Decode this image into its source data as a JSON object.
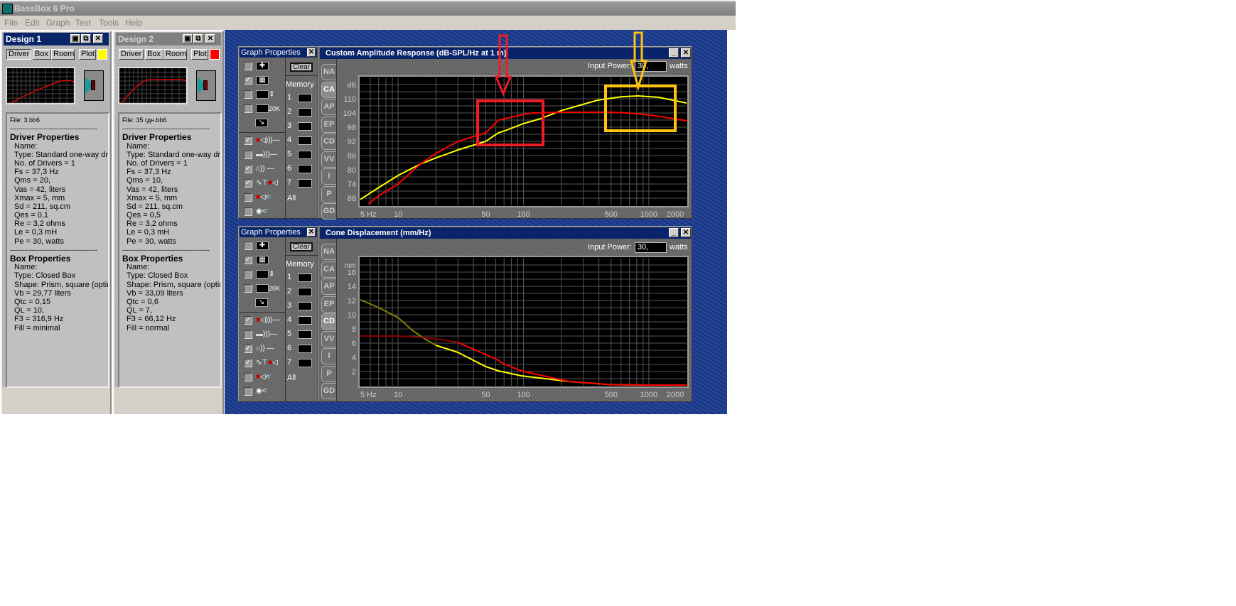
{
  "app": {
    "title": "BassBox 6 Pro",
    "menu": [
      "File",
      "Edit",
      "Graph",
      "Test",
      "Tools",
      "Help"
    ]
  },
  "designs": [
    {
      "title": "Design 1",
      "buttons": [
        "Driver",
        "Box",
        "Room",
        "Plot"
      ],
      "plot_color": "#ffff00",
      "file": "File: 3.bb6",
      "separator": "-----------------------------------------",
      "driver_heading": "Driver Properties",
      "driver_lines": [
        "Name:",
        "Type: Standard one-way driver",
        "No. of Drivers = 1",
        "Fs =  37,3 Hz",
        "Qms =  20,",
        "Vas =  42, liters",
        "Xmax =  5, mm",
        "Sd =  211, sq.cm",
        "Qes =  0,1",
        "Re =  3,2 ohms",
        "Le =  0,3 mH",
        "Pe =  30, watts"
      ],
      "box_heading": "Box Properties",
      "box_lines": [
        "Name:",
        "Type: Closed Box",
        "Shape: Prism, square (optimum)",
        "Vb =  29,77 liters",
        "Qtc =  0,15",
        "QL =  10,",
        "F3 =  316,9 Hz",
        "Fill = minimal"
      ]
    },
    {
      "title": "Design 2",
      "buttons": [
        "Driver",
        "Box",
        "Room",
        "Plot"
      ],
      "plot_color": "#ff0000",
      "file": "File: 35 гдн.bb6",
      "separator": "-----------------------------------------",
      "driver_heading": "Driver Properties",
      "driver_lines": [
        "Name:",
        "Type: Standard one-way driver",
        "No. of Drivers = 1",
        "Fs =  37,3 Hz",
        "Qms =  10,",
        "Vas =  42, liters",
        "Xmax =  5, mm",
        "Sd =  211, sq.cm",
        "Qes =  0,5",
        "Re =  3,2 ohms",
        "Le =  0,3 mH",
        "Pe =  30, watts"
      ],
      "box_heading": "Box Properties",
      "box_lines": [
        "Name:",
        "Type: Closed Box",
        "Shape: Prism, square (optimum)",
        "Vb =  33,09 liters",
        "Qtc =  0,6",
        "QL =  7,",
        "F3 =  66,12 Hz",
        "Fill = normal"
      ]
    }
  ],
  "graph_properties": {
    "title": "Graph Properties",
    "clear_label": "Clear",
    "memory_label": "Memory",
    "memory_slots": [
      "1",
      "2",
      "3",
      "4",
      "5",
      "6",
      "7"
    ],
    "all_label": "All",
    "options_top": [
      {
        "icon": "cursor-icon",
        "checked": false
      },
      {
        "icon": "grid-icon",
        "checked": true
      },
      {
        "icon": "autoscale-icon",
        "checked": false
      },
      {
        "icon": "extend-20k-icon",
        "checked": false
      }
    ],
    "extend_label": "20K",
    "options_bottom": [
      {
        "icon": "driver-response-icon",
        "checked": true
      },
      {
        "icon": "box-response-icon",
        "checked": false
      },
      {
        "icon": "room-response-icon",
        "checked": true
      },
      {
        "icon": "crossover-response-icon",
        "checked": true
      },
      {
        "icon": "driver-target-icon",
        "checked": false
      },
      {
        "icon": "box-target-icon",
        "checked": false
      }
    ]
  },
  "tabs": [
    "NA",
    "CA",
    "AP",
    "EP",
    "CD",
    "VV",
    "I",
    "P",
    "GD"
  ],
  "windows": [
    {
      "title": "Custom Amplitude Response (dB-SPL/Hz at 1 m)",
      "active_tab": "CA",
      "input_power_label": "Input Power:",
      "input_power_value": "30,",
      "units": "watts"
    },
    {
      "title": "Cone Displacement (mm/Hz)",
      "active_tab": "CD",
      "input_power_label": "Input Power:",
      "input_power_value": "30,",
      "units": "watts"
    }
  ],
  "chart_data": [
    {
      "type": "line",
      "title": "Custom Amplitude Response (dB-SPL/Hz at 1 m)",
      "xscale": "log",
      "xlim": [
        5,
        2000
      ],
      "ylim": [
        65,
        119
      ],
      "ygrid_step": 3,
      "grid": true,
      "ylabel": "dB",
      "xtick_labels": [
        [
          "5 Hz",
          5
        ],
        [
          "10",
          10
        ],
        [
          "50",
          50
        ],
        [
          "100",
          100
        ],
        [
          "500",
          500
        ],
        [
          "1000",
          1000
        ],
        [
          "2000",
          2000
        ]
      ],
      "ytick_labels": [
        "68",
        "74",
        "80",
        "86",
        "92",
        "98",
        "104",
        "110"
      ],
      "series": [
        {
          "name": "Design 1",
          "color": "#ffff00",
          "points": [
            [
              5,
              67.5
            ],
            [
              7,
              72.5
            ],
            [
              10,
              77.6
            ],
            [
              15,
              82.4
            ],
            [
              20,
              85
            ],
            [
              30,
              88.4
            ],
            [
              50,
              92
            ],
            [
              63,
              95.6
            ],
            [
              71,
              96.5
            ],
            [
              100,
              99.5
            ],
            [
              137,
              101.6
            ],
            [
              200,
              105
            ],
            [
              390,
              109.4
            ],
            [
              600,
              110.8
            ],
            [
              820,
              111.2
            ],
            [
              1200,
              110.6
            ],
            [
              2000,
              108.2
            ]
          ]
        },
        {
          "name": "Design 2",
          "color": "#ff0000",
          "points": [
            [
              5.8,
              65.6
            ],
            [
              7,
              69
            ],
            [
              10,
              74
            ],
            [
              15,
              82.4
            ],
            [
              20,
              86.9
            ],
            [
              30,
              92
            ],
            [
              50,
              95.6
            ],
            [
              63,
              101
            ],
            [
              71,
              101.6
            ],
            [
              100,
              103.4
            ],
            [
              120,
              104
            ],
            [
              200,
              104.3
            ],
            [
              500,
              104.3
            ],
            [
              800,
              103.8
            ],
            [
              1200,
              102.6
            ],
            [
              2000,
              100.7
            ]
          ]
        }
      ]
    },
    {
      "type": "line",
      "title": "Cone Displacement (mm/Hz)",
      "xscale": "log",
      "xlim": [
        5,
        2000
      ],
      "ylim": [
        0,
        18
      ],
      "ygrid_step": 1,
      "grid": true,
      "ylabel": "mm",
      "xtick_labels": [
        [
          "5 Hz",
          5
        ],
        [
          "10",
          10
        ],
        [
          "50",
          50
        ],
        [
          "100",
          100
        ],
        [
          "500",
          500
        ],
        [
          "1000",
          1000
        ],
        [
          "2000",
          2000
        ]
      ],
      "ytick_labels": [
        "2",
        "4",
        "6",
        "8",
        "10",
        "12",
        "14",
        "16"
      ],
      "series": [
        {
          "name": "Design 1",
          "color": "#ffff00",
          "dim_color": "#808000",
          "dim_below_hz": 25,
          "points": [
            [
              5,
              12.1
            ],
            [
              7,
              11
            ],
            [
              10,
              9.6
            ],
            [
              13,
              7.8
            ],
            [
              16,
              6.7
            ],
            [
              20,
              5.7
            ],
            [
              30,
              4.7
            ],
            [
              50,
              2.7
            ],
            [
              63,
              2.1
            ],
            [
              96,
              1.4
            ],
            [
              230,
              0.6
            ],
            [
              500,
              0.15
            ],
            [
              1000,
              0.1
            ],
            [
              2000,
              0.1
            ]
          ]
        },
        {
          "name": "Design 2",
          "color": "#ff0000",
          "dim_color": "#8b0000",
          "dim_below_hz": 40,
          "points": [
            [
              5,
              7
            ],
            [
              10,
              7
            ],
            [
              16,
              6.8
            ],
            [
              20,
              6.6
            ],
            [
              30,
              6.1
            ],
            [
              50,
              4.4
            ],
            [
              63,
              3.6
            ],
            [
              68,
              3.2
            ],
            [
              96,
              2.1
            ],
            [
              230,
              0.6
            ],
            [
              500,
              0.15
            ],
            [
              1000,
              0.1
            ],
            [
              2000,
              0.1
            ]
          ]
        }
      ]
    }
  ]
}
